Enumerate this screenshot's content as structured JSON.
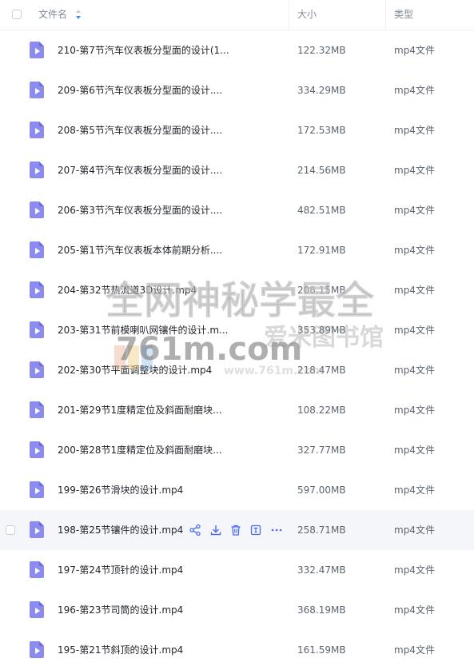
{
  "header": {
    "name_label": "文件名",
    "size_label": "大小",
    "type_label": "类型"
  },
  "colors": {
    "accent": "#8c8cf0",
    "icon_dark": "#6a6ad8",
    "action": "#4b6cf0"
  },
  "files": [
    {
      "name": "210-第7节汽车仪表板分型面的设计(1...",
      "size": "122.32MB",
      "type": "mp4文件"
    },
    {
      "name": "209-第6节汽车仪表板分型面的设计....",
      "size": "334.29MB",
      "type": "mp4文件"
    },
    {
      "name": "208-第5节汽车仪表板分型面的设计....",
      "size": "172.53MB",
      "type": "mp4文件"
    },
    {
      "name": "207-第4节汽车仪表板分型面的设计....",
      "size": "214.56MB",
      "type": "mp4文件"
    },
    {
      "name": "206-第3节汽车仪表板分型面的设计....",
      "size": "482.51MB",
      "type": "mp4文件"
    },
    {
      "name": "205-第1节汽车仪表板本体前期分析....",
      "size": "172.91MB",
      "type": "mp4文件"
    },
    {
      "name": "204-第32节热流道3D设计.mp4",
      "size": "208.15MB",
      "type": "mp4文件"
    },
    {
      "name": "203-第31节前模喇叭网镶件的设计.m...",
      "size": "353.89MB",
      "type": "mp4文件"
    },
    {
      "name": "202-第30节平面调整块的设计.mp4",
      "size": "218.47MB",
      "type": "mp4文件"
    },
    {
      "name": "201-第29节1度精定位及斜面耐磨块...",
      "size": "108.22MB",
      "type": "mp4文件"
    },
    {
      "name": "200-第28节1度精定位及斜面耐磨块...",
      "size": "327.77MB",
      "type": "mp4文件"
    },
    {
      "name": "199-第26节滑块的设计.mp4",
      "size": "597.00MB",
      "type": "mp4文件"
    },
    {
      "name": "198-第25节镶件的设计.mp4",
      "size": "258.71MB",
      "type": "mp4文件"
    },
    {
      "name": "197-第24节顶针的设计.mp4",
      "size": "332.47MB",
      "type": "mp4文件"
    },
    {
      "name": "196-第23节司筒的设计.mp4",
      "size": "368.19MB",
      "type": "mp4文件"
    },
    {
      "name": "195-第21节斜顶的设计.mp4",
      "size": "161.59MB",
      "type": "mp4文件"
    }
  ],
  "hovered_row_actions": [
    "share-icon",
    "download-icon",
    "delete-icon",
    "rename-icon",
    "more-icon"
  ],
  "watermark": {
    "line1": "全网神秘学最全",
    "line2": "761m.com",
    "line3": "爱米图书馆",
    "url": "www.761m.com"
  }
}
